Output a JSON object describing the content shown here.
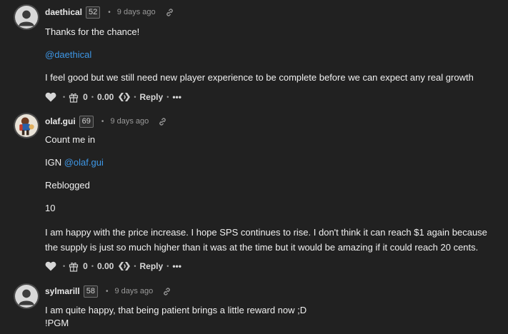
{
  "comments": [
    {
      "author": "daethical",
      "reputation": "52",
      "age": "9 days ago",
      "lines": [
        "Thanks for the chance!",
        "@daethical",
        "I feel good but we still need new player experience to be complete before we can expect any real growth"
      ],
      "votes": "0",
      "payout": "0.00",
      "reply_label": "Reply",
      "more_label": "•••"
    },
    {
      "author": "olaf.gui",
      "reputation": "69",
      "age": "9 days ago",
      "lines": [
        "Count me in",
        "IGN ",
        "@olaf.gui",
        "Reblogged",
        "10",
        "I am happy with the price increase. I hope SPS continues to rise. I don't think it can reach $1 again because the supply is just so much higher than it was at the time but it would be amazing if it could reach 20 cents."
      ],
      "votes": "0",
      "payout": "0.00",
      "reply_label": "Reply",
      "more_label": "•••"
    },
    {
      "author": "sylmarill",
      "reputation": "58",
      "age": "9 days ago",
      "lines": [
        "I am quite happy, that being patient brings a little reward now ;D",
        "!PGM"
      ]
    }
  ],
  "colors": {
    "background": "#212121",
    "mention": "#3e97e6",
    "muted": "#999999"
  },
  "icons": {
    "link": "link-icon",
    "upvote": "heart-icon",
    "gift": "gift-icon",
    "share": "hive-share-icon"
  }
}
